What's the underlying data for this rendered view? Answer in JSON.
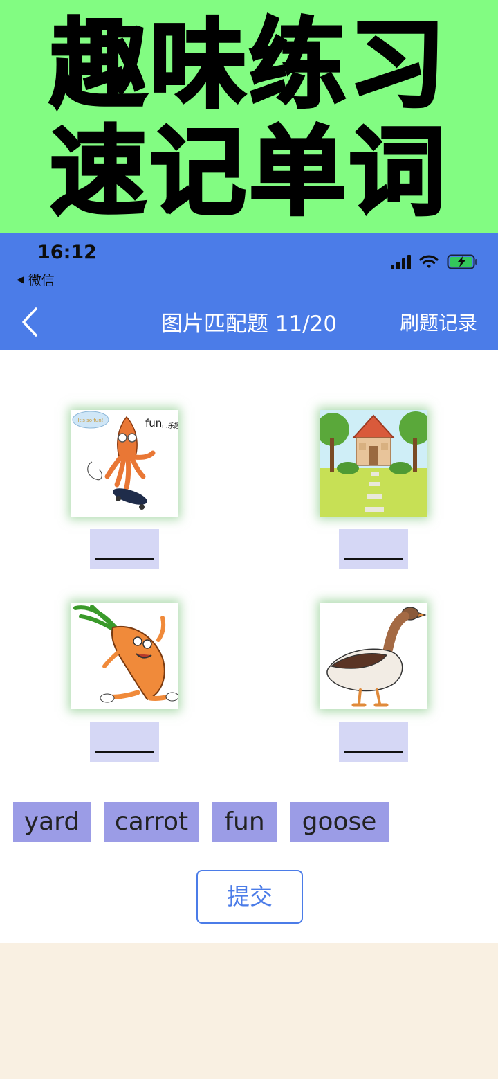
{
  "banner": {
    "line1": "趣味练习",
    "line2": "速记单词"
  },
  "status_bar": {
    "time": "16:12",
    "back_app": "微信"
  },
  "nav": {
    "title": "图片匹配题 11/20",
    "record_label": "刷题记录"
  },
  "cards": [
    {
      "image": "octopus-skateboard-fun",
      "caption_in_image": "fun",
      "caption_sub": "n.乐趣",
      "bubble": "It's so fun!",
      "answer": ""
    },
    {
      "image": "house-yard",
      "answer": ""
    },
    {
      "image": "carrot-dancing",
      "answer": ""
    },
    {
      "image": "goose",
      "answer": ""
    }
  ],
  "choices": [
    "yard",
    "carrot",
    "fun",
    "goose"
  ],
  "submit_label": "提交",
  "colors": {
    "banner_bg": "#82fc82",
    "header_bg": "#4b7ce8",
    "chip_bg": "#9b9ce6",
    "blank_bg": "#d5d7f5",
    "footer_bg": "#f9f0e2"
  }
}
